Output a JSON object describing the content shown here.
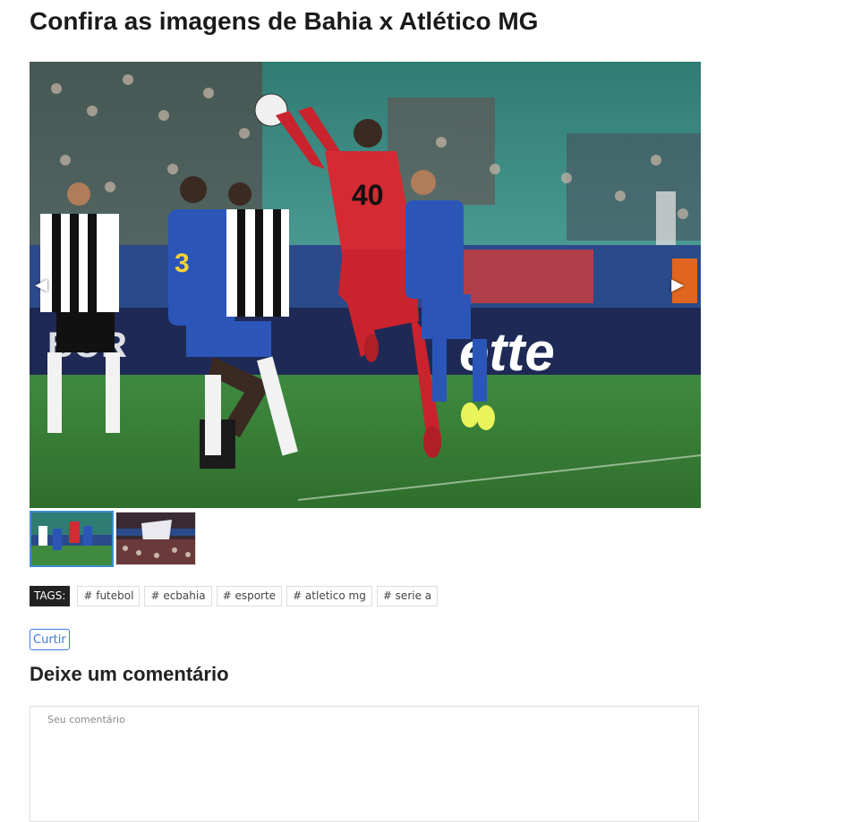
{
  "article": {
    "title": "Confira as imagens de Bahia x Atlético MG"
  },
  "gallery": {
    "prev_arrow": "◀",
    "next_arrow": "▶",
    "main_image": {
      "board_text_left": "BOR",
      "board_text_right": "ette",
      "player_number_keeper": "40",
      "player_number_bahia": "3"
    },
    "thumbnails_count": 2,
    "selected_thumbnail": 1
  },
  "tags": {
    "label": "TAGS:",
    "items": [
      "# futebol",
      "# ecbahia",
      "# esporte",
      "# atletico mg",
      "# serie a"
    ]
  },
  "like_button": {
    "label": "Curtir"
  },
  "comments": {
    "title": "Deixe um comentário",
    "placeholder": "Seu comentário",
    "value": ""
  },
  "colors": {
    "accent": "#3b7dd8",
    "selected_thumb_border": "#3b8fd0",
    "tags_label_bg": "#222222"
  }
}
